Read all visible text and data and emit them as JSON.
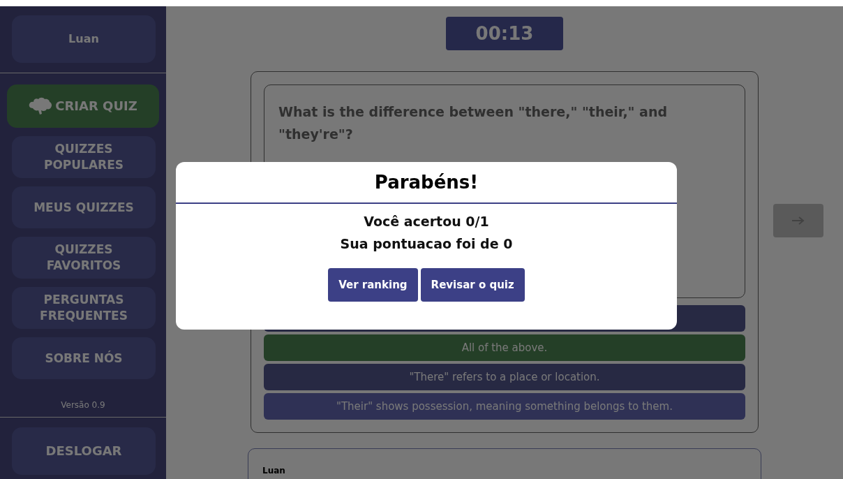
{
  "sidebar": {
    "user": "Luan",
    "create_button": "CRIAR QUIZ",
    "items": [
      {
        "label": "QUIZZES POPULARES"
      },
      {
        "label": "MEUS QUIZZES"
      },
      {
        "label": "QUIZZES FAVORITOS"
      },
      {
        "label": "PERGUNTAS FREQUENTES"
      },
      {
        "label": "SOBRE NÓS"
      }
    ],
    "version": "Versão 0.9",
    "logout": "DESLOGAR"
  },
  "timer": "00:13",
  "question": {
    "text": "What is the difference between \"there,\" \"their,\" and \"they're\"?",
    "answers": [
      {
        "kind": "wrong"
      },
      {
        "label": "All of the above.",
        "kind": "correct"
      },
      {
        "label": "\"There\" refers to a place or location.",
        "kind": "wrong"
      },
      {
        "label": "\"Their\" shows possession, meaning something belongs to them.",
        "kind": "neutral"
      }
    ]
  },
  "next_button": {
    "disabled": true
  },
  "comment_card": {
    "author": "Luan"
  },
  "modal": {
    "title": "Parabéns!",
    "lines": [
      "Você acertou 0/1",
      "Sua pontuacao foi de 0"
    ],
    "buttons": [
      "Ver ranking",
      "Revisar o quiz"
    ]
  }
}
